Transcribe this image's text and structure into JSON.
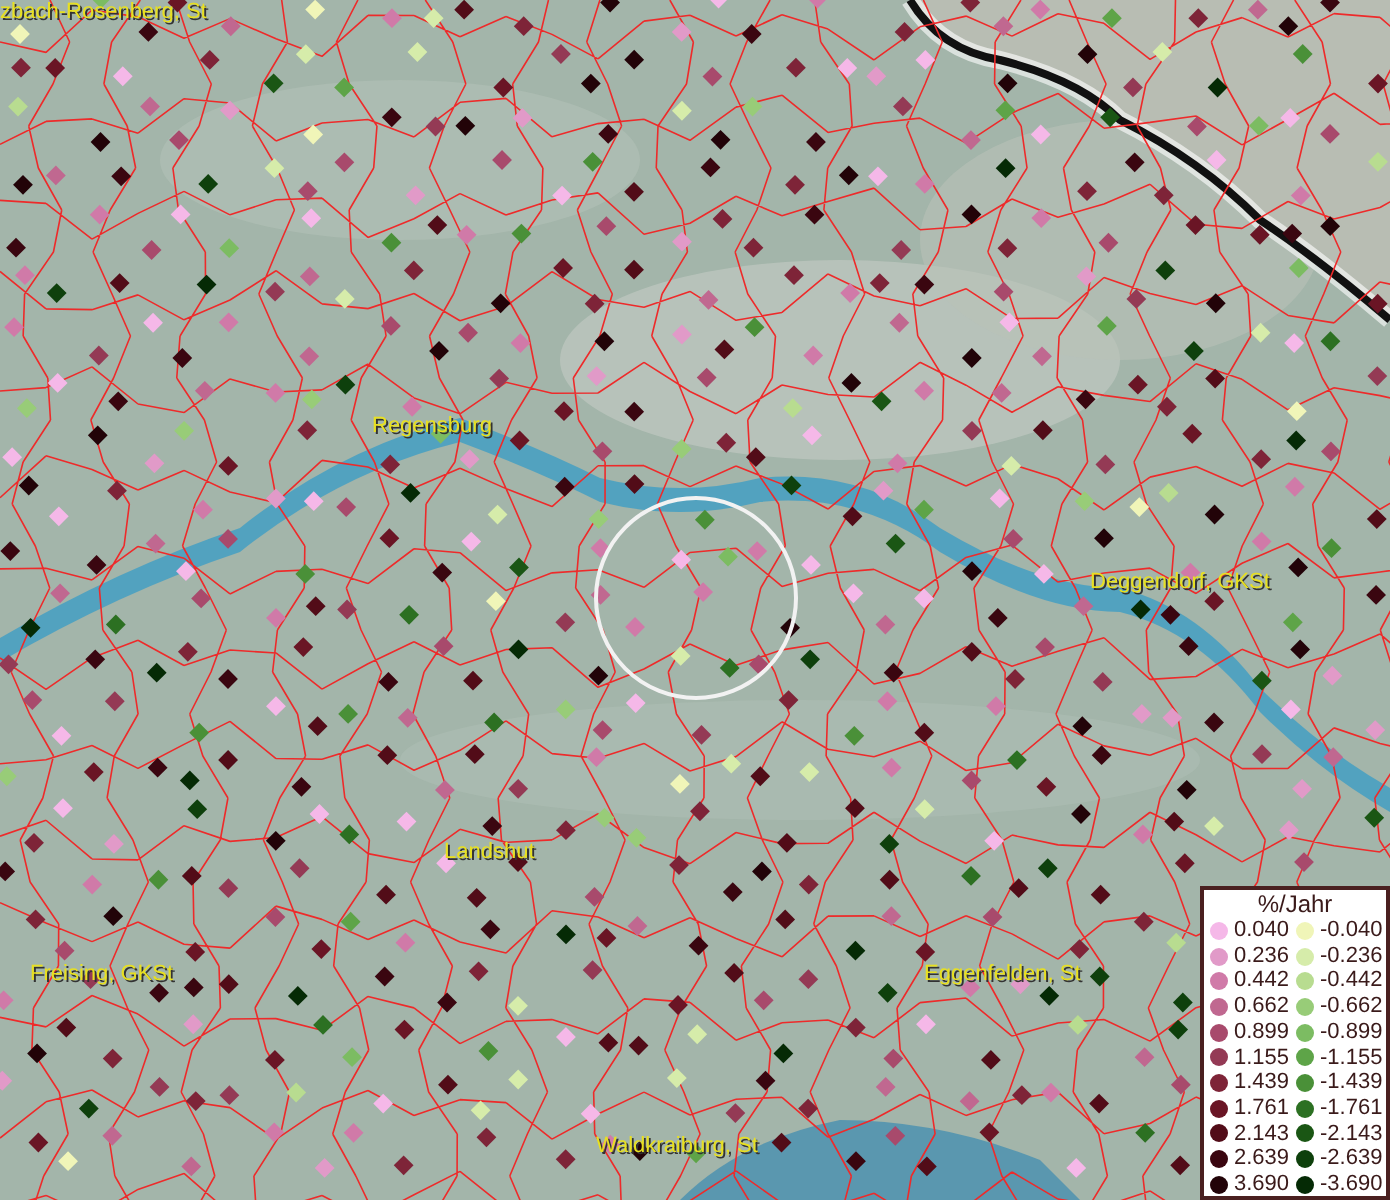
{
  "map": {
    "labels": [
      {
        "text": "zbach-Rosenberg, St"
      },
      {
        "text": "Regensburg"
      },
      {
        "text": "Deggendorf, GKSt"
      },
      {
        "text": "Landshut"
      },
      {
        "text": "Freising, GKSt"
      },
      {
        "text": "Eggenfelden, St"
      },
      {
        "text": "Waldkraiburg, St"
      }
    ]
  },
  "legend": {
    "title": "%/Jahr",
    "positive": [
      {
        "value": "0.040",
        "color": "#f5b8e8"
      },
      {
        "value": "0.236",
        "color": "#e19ac8"
      },
      {
        "value": "0.442",
        "color": "#d07aa8"
      },
      {
        "value": "0.662",
        "color": "#c06890"
      },
      {
        "value": "0.899",
        "color": "#a84a6c"
      },
      {
        "value": "1.155",
        "color": "#943a55"
      },
      {
        "value": "1.439",
        "color": "#7e2438"
      },
      {
        "value": "1.761",
        "color": "#6a1525"
      },
      {
        "value": "2.143",
        "color": "#520c18"
      },
      {
        "value": "2.639",
        "color": "#3a0610"
      },
      {
        "value": "3.690",
        "color": "#220308"
      }
    ],
    "negative": [
      {
        "value": "-0.040",
        "color": "#f0f5b8"
      },
      {
        "value": "-0.236",
        "color": "#d6ecaa"
      },
      {
        "value": "-0.442",
        "color": "#b8dc90"
      },
      {
        "value": "-0.662",
        "color": "#98cc78"
      },
      {
        "value": "-0.899",
        "color": "#7cbc62"
      },
      {
        "value": "-1.155",
        "color": "#5ea448"
      },
      {
        "value": "-1.439",
        "color": "#4a9038"
      },
      {
        "value": "-1.761",
        "color": "#2c7022"
      },
      {
        "value": "-2.143",
        "color": "#1a5614"
      },
      {
        "value": "-2.639",
        "color": "#0e400c"
      },
      {
        "value": "-3.690",
        "color": "#052a05"
      }
    ]
  }
}
